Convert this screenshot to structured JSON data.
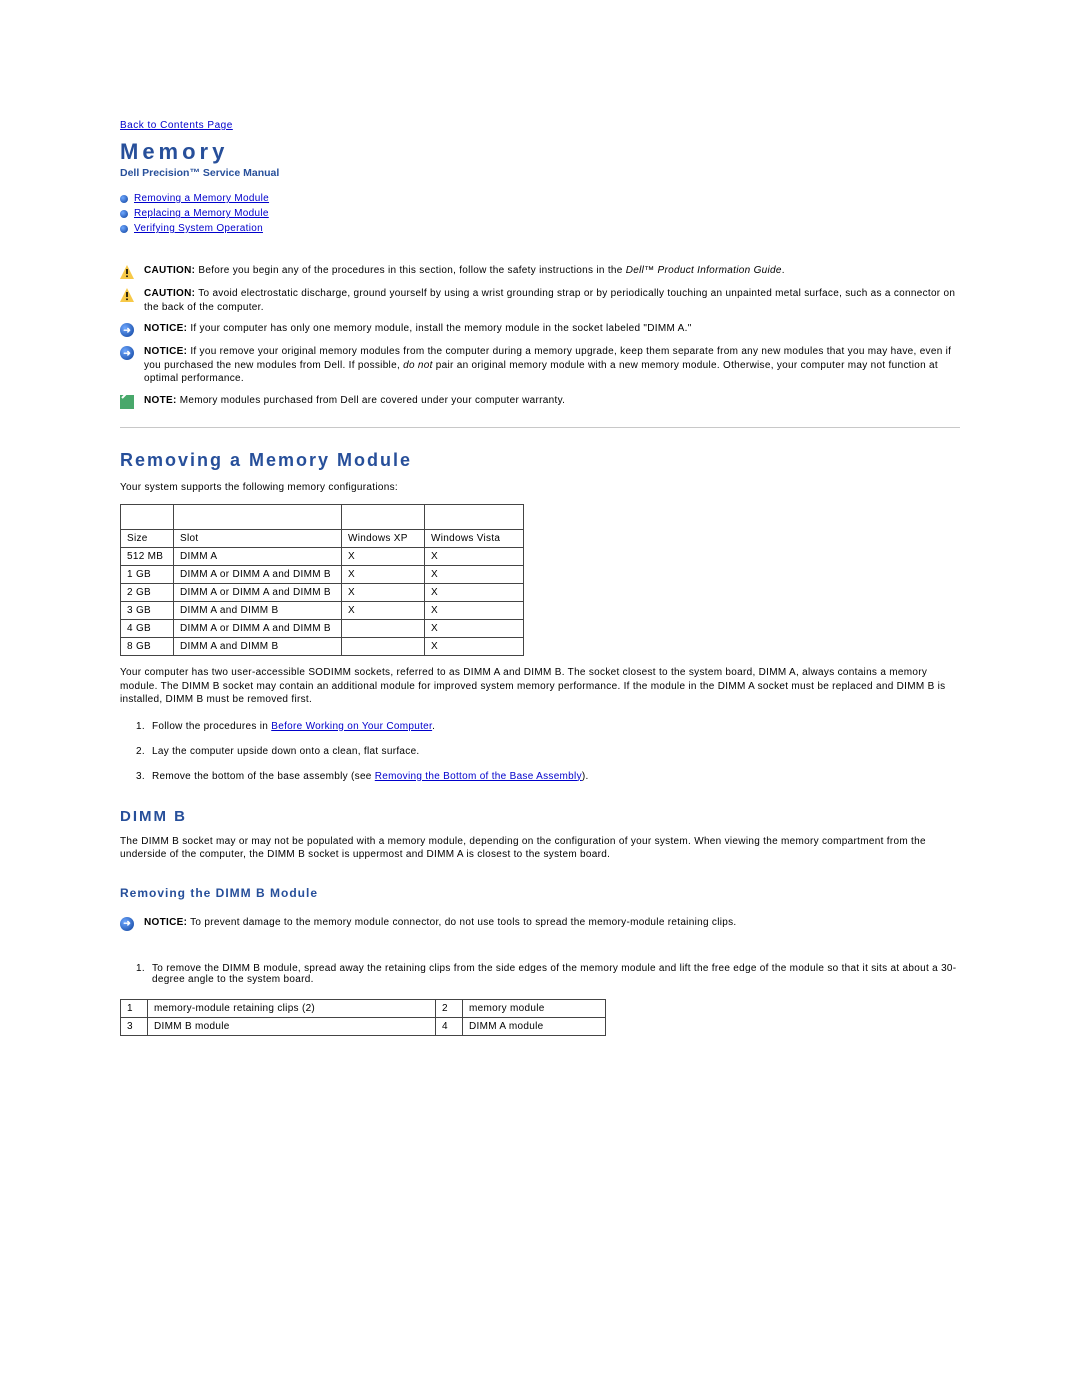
{
  "nav": {
    "back_link": "Back to Contents Page"
  },
  "header": {
    "title": "Memory",
    "subtitle": "Dell Precision™ Service Manual"
  },
  "toc": {
    "items": [
      {
        "label": "Removing a Memory Module"
      },
      {
        "label": "Replacing a Memory Module"
      },
      {
        "label": "Verifying System Operation"
      }
    ]
  },
  "alerts": [
    {
      "icon": "caution",
      "label": "CAUTION:",
      "before": "Before you begin any of the procedures in this section, follow the safety instructions in the ",
      "italic": "Dell™ Product Information Guide",
      "after": "."
    },
    {
      "icon": "caution",
      "label": "CAUTION:",
      "text": "To avoid electrostatic discharge, ground yourself by using a wrist grounding strap or by periodically touching an unpainted metal surface, such as a connector on the back of the computer."
    },
    {
      "icon": "notice",
      "label": "NOTICE:",
      "text": "If your computer has only one memory module, install the memory module in the socket labeled \"DIMM A.\""
    },
    {
      "icon": "notice",
      "label": "NOTICE:",
      "before": "If you remove your original memory modules from the computer during a memory upgrade, keep them separate from any new modules that you may have, even if you purchased the new modules from Dell. If possible, ",
      "italic": "do not",
      "after": " pair an original memory module with a new memory module. Otherwise, your computer may not function at optimal performance."
    },
    {
      "icon": "note",
      "label": "NOTE:",
      "text": "Memory modules purchased from Dell are covered under your computer warranty."
    }
  ],
  "section_removing": {
    "heading": "Removing a Memory Module",
    "intro": "Your system supports the following memory configurations:",
    "table_headers": {
      "c1": "Size",
      "c2": "Slot",
      "c3": "Windows XP",
      "c4": "Windows Vista"
    },
    "table_rows": [
      {
        "size": "512 MB",
        "slot": "DIMM A",
        "xp": "X",
        "vista": "X"
      },
      {
        "size": "1 GB",
        "slot": "DIMM A or DIMM A and DIMM B",
        "xp": "X",
        "vista": "X"
      },
      {
        "size": "2 GB",
        "slot": "DIMM A or DIMM A and DIMM B",
        "xp": "X",
        "vista": "X"
      },
      {
        "size": "3 GB",
        "slot": "DIMM A and DIMM B",
        "xp": "X",
        "vista": "X"
      },
      {
        "size": "4 GB",
        "slot": "DIMM A or DIMM A and DIMM B",
        "xp": "",
        "vista": "X"
      },
      {
        "size": "8 GB",
        "slot": "DIMM A and DIMM B",
        "xp": "",
        "vista": "X"
      }
    ],
    "para2": "Your computer has two user-accessible SODIMM sockets, referred to as DIMM A and DIMM B. The socket closest to the system board, DIMM A, always contains a memory module. The DIMM B socket may contain an additional module for improved system memory performance. If the module in the DIMM A socket must be replaced and DIMM B is installed, DIMM B must be removed first.",
    "steps": {
      "s1_before": "Follow the procedures in ",
      "s1_link": "Before Working on Your Computer",
      "s1_after": ".",
      "s2": "Lay the computer upside down onto a clean, flat surface.",
      "s3_before": "Remove the bottom of the base assembly (see ",
      "s3_link": "Removing the Bottom of the Base Assembly",
      "s3_after": ")."
    }
  },
  "dimm_b": {
    "heading": "DIMM B",
    "para": "The DIMM B socket may or may not be populated with a memory module, depending on the configuration of your system. When viewing the memory compartment from the underside of the computer, the DIMM B socket is uppermost and DIMM A is closest to the system board.",
    "subheading": "Removing the DIMM B Module",
    "notice": {
      "label": "NOTICE:",
      "text": "To prevent damage to the memory module connector, do not use tools to spread the memory-module retaining clips."
    },
    "step1": "To remove the DIMM B module, spread away the retaining clips from the side edges of the memory module and lift the free edge of the module so that it sits at about a 30-degree angle to the system board.",
    "parts": [
      {
        "n": "1",
        "d": "memory-module retaining clips (2)"
      },
      {
        "n": "2",
        "d": "memory module"
      },
      {
        "n": "3",
        "d": "DIMM B module"
      },
      {
        "n": "4",
        "d": "DIMM A module"
      }
    ]
  }
}
